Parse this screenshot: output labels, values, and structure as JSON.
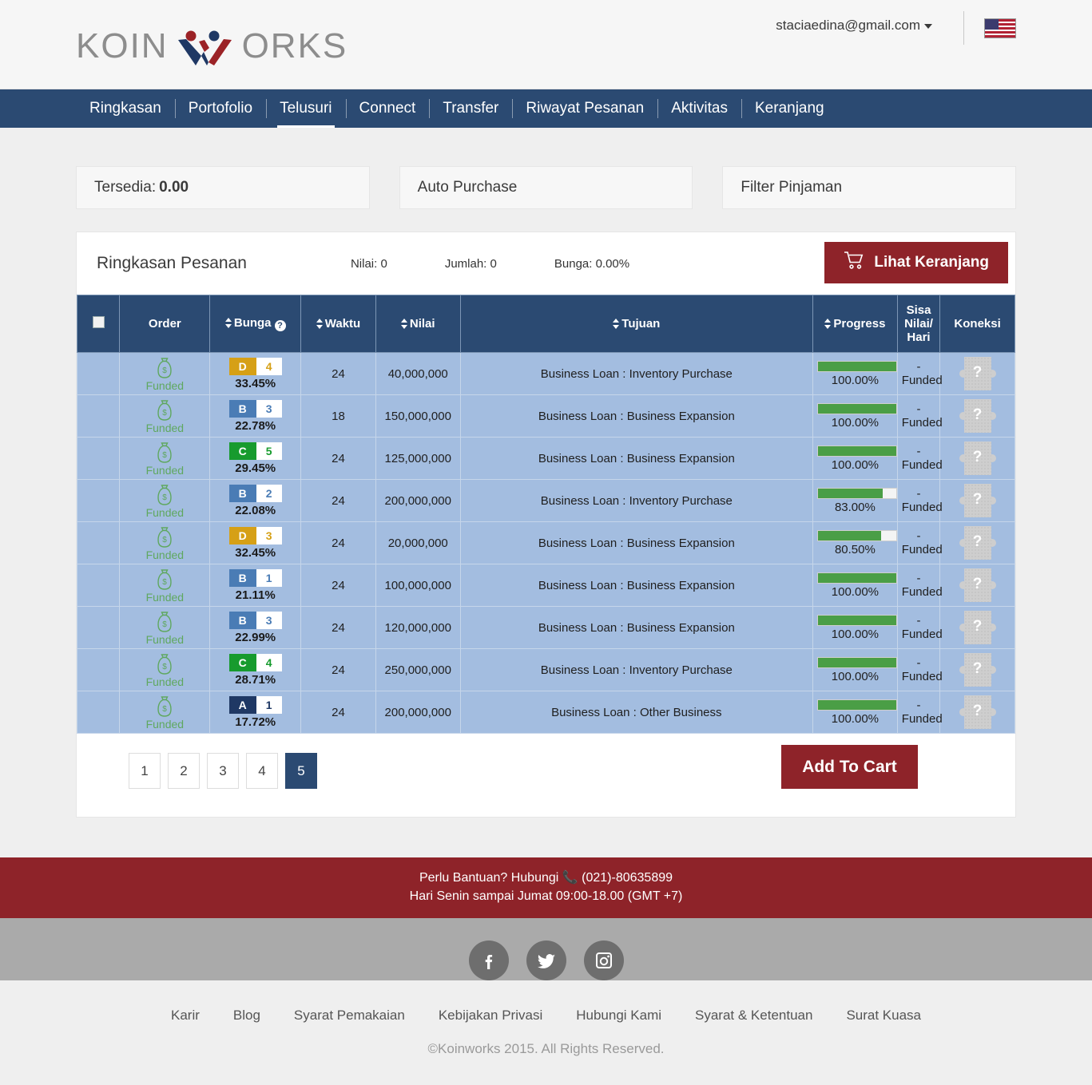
{
  "brand": {
    "name_left": "KOIN",
    "name_right": "ORKS",
    "logo_icon": "koinworks-logo"
  },
  "topbar": {
    "account_email": "staciaedina@gmail.com",
    "caret_icon": "chevron-down-icon",
    "flag_icon": "us-flag-icon"
  },
  "nav": {
    "items": [
      {
        "label": "Ringkasan",
        "active": false
      },
      {
        "label": "Portofolio",
        "active": false
      },
      {
        "label": "Telusuri",
        "active": true
      },
      {
        "label": "Connect",
        "active": false
      },
      {
        "label": "Transfer",
        "active": false
      },
      {
        "label": "Riwayat Pesanan",
        "active": false
      },
      {
        "label": "Aktivitas",
        "active": false
      },
      {
        "label": "Keranjang",
        "active": false
      }
    ]
  },
  "panels": {
    "tersedia_label": "Tersedia:",
    "tersedia_value": "0.00",
    "auto_purchase": "Auto Purchase",
    "filter_pinjaman": "Filter Pinjaman"
  },
  "order_summary": {
    "title": "Ringkasan Pesanan",
    "nilai": "Nilai: 0",
    "jumlah": "Jumlah: 0",
    "bunga": "Bunga: 0.00%",
    "cart_button": "Lihat Keranjang",
    "cart_icon": "shopping-cart-icon"
  },
  "table": {
    "headers": {
      "select": "",
      "order": "Order",
      "bunga": "Bunga",
      "waktu": "Waktu",
      "nilai": "Nilai",
      "tujuan": "Tujuan",
      "progress": "Progress",
      "sisa_line1": "Sisa",
      "sisa_line2": "Nilai/",
      "sisa_line3": "Hari",
      "koneksi": "Koneksi",
      "help_icon": "question-mark-icon"
    },
    "rows": [
      {
        "status": "Funded",
        "grade": "D",
        "grade_num": "4",
        "grade_color": "#d6a016",
        "rate": "33.45%",
        "waktu": "24",
        "nilai": "40,000,000",
        "tujuan": "Business Loan : Inventory Purchase",
        "progress": "100.00%",
        "progress_pct": 100,
        "sisa_dash": "-",
        "sisa_status": "Funded",
        "koneksi_icon": "broken-image-icon"
      },
      {
        "status": "Funded",
        "grade": "B",
        "grade_num": "3",
        "grade_color": "#4a7cb5",
        "rate": "22.78%",
        "waktu": "18",
        "nilai": "150,000,000",
        "tujuan": "Business Loan : Business Expansion",
        "progress": "100.00%",
        "progress_pct": 100,
        "sisa_dash": "-",
        "sisa_status": "Funded",
        "koneksi_icon": "broken-image-icon"
      },
      {
        "status": "Funded",
        "grade": "C",
        "grade_num": "5",
        "grade_color": "#179b2e",
        "rate": "29.45%",
        "waktu": "24",
        "nilai": "125,000,000",
        "tujuan": "Business Loan : Business Expansion",
        "progress": "100.00%",
        "progress_pct": 100,
        "sisa_dash": "-",
        "sisa_status": "Funded",
        "koneksi_icon": "broken-image-icon"
      },
      {
        "status": "Funded",
        "grade": "B",
        "grade_num": "2",
        "grade_color": "#4a7cb5",
        "rate": "22.08%",
        "waktu": "24",
        "nilai": "200,000,000",
        "tujuan": "Business Loan : Inventory Purchase",
        "progress": "83.00%",
        "progress_pct": 83,
        "sisa_dash": "-",
        "sisa_status": "Funded",
        "koneksi_icon": "broken-image-icon"
      },
      {
        "status": "Funded",
        "grade": "D",
        "grade_num": "3",
        "grade_color": "#d6a016",
        "rate": "32.45%",
        "waktu": "24",
        "nilai": "20,000,000",
        "tujuan": "Business Loan : Business Expansion",
        "progress": "80.50%",
        "progress_pct": 80.5,
        "sisa_dash": "-",
        "sisa_status": "Funded",
        "koneksi_icon": "broken-image-icon"
      },
      {
        "status": "Funded",
        "grade": "B",
        "grade_num": "1",
        "grade_color": "#4a7cb5",
        "rate": "21.11%",
        "waktu": "24",
        "nilai": "100,000,000",
        "tujuan": "Business Loan : Business Expansion",
        "progress": "100.00%",
        "progress_pct": 100,
        "sisa_dash": "-",
        "sisa_status": "Funded",
        "koneksi_icon": "broken-image-icon"
      },
      {
        "status": "Funded",
        "grade": "B",
        "grade_num": "3",
        "grade_color": "#4a7cb5",
        "rate": "22.99%",
        "waktu": "24",
        "nilai": "120,000,000",
        "tujuan": "Business Loan : Business Expansion",
        "progress": "100.00%",
        "progress_pct": 100,
        "sisa_dash": "-",
        "sisa_status": "Funded",
        "koneksi_icon": "broken-image-icon"
      },
      {
        "status": "Funded",
        "grade": "C",
        "grade_num": "4",
        "grade_color": "#179b2e",
        "rate": "28.71%",
        "waktu": "24",
        "nilai": "250,000,000",
        "tujuan": "Business Loan : Inventory Purchase",
        "progress": "100.00%",
        "progress_pct": 100,
        "sisa_dash": "-",
        "sisa_status": "Funded",
        "koneksi_icon": "broken-image-icon"
      },
      {
        "status": "Funded",
        "grade": "A",
        "grade_num": "1",
        "grade_color": "#1f3864",
        "rate": "17.72%",
        "waktu": "24",
        "nilai": "200,000,000",
        "tujuan": "Business Loan : Other Business",
        "progress": "100.00%",
        "progress_pct": 100,
        "sisa_dash": "-",
        "sisa_status": "Funded",
        "koneksi_icon": "broken-image-icon"
      }
    ]
  },
  "pagination": {
    "pages": [
      {
        "label": "1",
        "active": false
      },
      {
        "label": "2",
        "active": false
      },
      {
        "label": "3",
        "active": false
      },
      {
        "label": "4",
        "active": false
      },
      {
        "label": "5",
        "active": true
      }
    ],
    "add_to_cart": "Add To Cart"
  },
  "help_bar": {
    "line1_prefix": "Perlu Bantuan? Hubungi",
    "phone_icon": "phone-icon",
    "phone": "(021)-80635899",
    "line2": "Hari Senin sampai Jumat 09:00-18.00 (GMT +7)"
  },
  "site_footer": {
    "socials": [
      {
        "name": "facebook-icon",
        "glyph": "f"
      },
      {
        "name": "twitter-icon",
        "glyph": "t"
      },
      {
        "name": "instagram-icon",
        "glyph": "i"
      }
    ],
    "links": [
      "Karir",
      "Blog",
      "Syarat Pemakaian",
      "Kebijakan Privasi",
      "Hubungi Kami",
      "Syarat & Ketentuan",
      "Surat Kuasa"
    ],
    "copyright": "©Koinworks 2015. All Rights Reserved."
  },
  "colors": {
    "nav_blue": "#2b4a72",
    "accent_red": "#8e2329",
    "row_blue": "#a3bde0",
    "progress_green": "#4a9e46",
    "funded_green": "#5fa85f"
  }
}
